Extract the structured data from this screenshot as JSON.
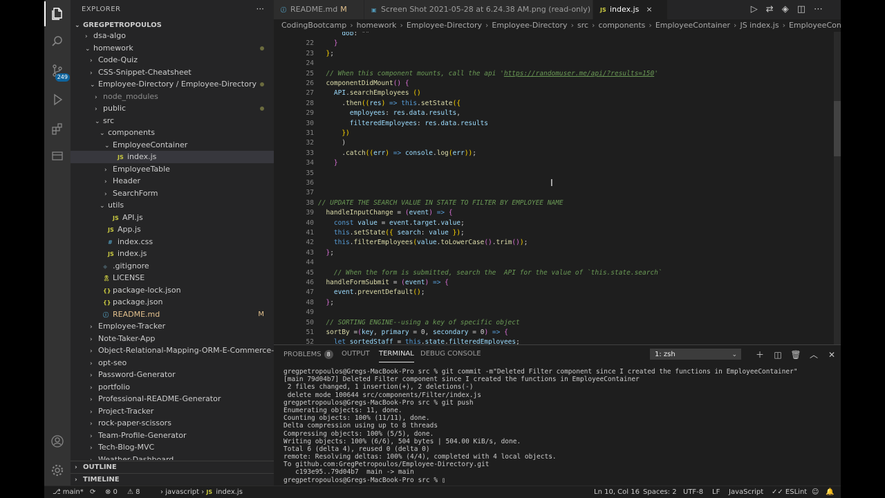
{
  "activity_bar": {
    "scm_badge": "249"
  },
  "sidebar": {
    "title": "EXPLORER",
    "more": "···",
    "root": "GREGPETROPOULOS",
    "items": [
      {
        "label": "dsa-algo",
        "indent": 1,
        "chev": "›",
        "icon": ""
      },
      {
        "label": "homework",
        "indent": 1,
        "chev": "⌄",
        "icon": "",
        "dot": true
      },
      {
        "label": "Code-Quiz",
        "indent": 2,
        "chev": "›",
        "icon": ""
      },
      {
        "label": "CSS-Snippet-Cheatsheet",
        "indent": 2,
        "chev": "›",
        "icon": ""
      },
      {
        "label": "Employee-Directory / Employee-Directory",
        "indent": 2,
        "chev": "⌄",
        "icon": "",
        "dot": true
      },
      {
        "label": "node_modules",
        "indent": 3,
        "chev": "›",
        "icon": "",
        "dim": true
      },
      {
        "label": "public",
        "indent": 3,
        "chev": "›",
        "icon": "",
        "dot": true
      },
      {
        "label": "src",
        "indent": 3,
        "chev": "⌄",
        "icon": ""
      },
      {
        "label": "components",
        "indent": 4,
        "chev": "⌄",
        "icon": ""
      },
      {
        "label": "EmployeeContainer",
        "indent": 5,
        "chev": "⌄",
        "icon": ""
      },
      {
        "label": "index.js",
        "indent": 6,
        "chev": "",
        "icon": "JS",
        "icls": "js",
        "selected": true
      },
      {
        "label": "EmployeeTable",
        "indent": 5,
        "chev": "›",
        "icon": ""
      },
      {
        "label": "Header",
        "indent": 5,
        "chev": "›",
        "icon": ""
      },
      {
        "label": "SearchForm",
        "indent": 5,
        "chev": "›",
        "icon": ""
      },
      {
        "label": "utils",
        "indent": 4,
        "chev": "⌄",
        "icon": ""
      },
      {
        "label": "API.js",
        "indent": 5,
        "chev": "",
        "icon": "JS",
        "icls": "js"
      },
      {
        "label": "App.js",
        "indent": 4,
        "chev": "",
        "icon": "JS",
        "icls": "js"
      },
      {
        "label": "index.css",
        "indent": 4,
        "chev": "",
        "icon": "#",
        "icls": "css"
      },
      {
        "label": "index.js",
        "indent": 4,
        "chev": "",
        "icon": "JS",
        "icls": "js"
      },
      {
        "label": ".gitignore",
        "indent": 3,
        "chev": "",
        "icon": "◆",
        "icls": "gi"
      },
      {
        "label": "LICENSE",
        "indent": 3,
        "chev": "",
        "icon": "🎗",
        "icls": "lic"
      },
      {
        "label": "package-lock.json",
        "indent": 3,
        "chev": "",
        "icon": "{}",
        "icls": "json"
      },
      {
        "label": "package.json",
        "indent": 3,
        "chev": "",
        "icon": "{}",
        "icls": "json"
      },
      {
        "label": "README.md",
        "indent": 3,
        "chev": "",
        "icon": "ⓘ",
        "icls": "md",
        "modified": "M"
      },
      {
        "label": "Employee-Tracker",
        "indent": 2,
        "chev": "›",
        "icon": ""
      },
      {
        "label": "Note-Taker-App",
        "indent": 2,
        "chev": "›",
        "icon": ""
      },
      {
        "label": "Object-Relational-Mapping-ORM-E-Commerce-B...",
        "indent": 2,
        "chev": "›",
        "icon": ""
      },
      {
        "label": "opt-seo",
        "indent": 2,
        "chev": "›",
        "icon": ""
      },
      {
        "label": "Password-Generator",
        "indent": 2,
        "chev": "›",
        "icon": ""
      },
      {
        "label": "portfolio",
        "indent": 2,
        "chev": "›",
        "icon": ""
      },
      {
        "label": "Professional-README-Generator",
        "indent": 2,
        "chev": "›",
        "icon": ""
      },
      {
        "label": "Project-Tracker",
        "indent": 2,
        "chev": "›",
        "icon": ""
      },
      {
        "label": "rock-paper-scissors",
        "indent": 2,
        "chev": "›",
        "icon": ""
      },
      {
        "label": "Team-Profile-Generator",
        "indent": 2,
        "chev": "›",
        "icon": ""
      },
      {
        "label": "Tech-Blog-MVC",
        "indent": 2,
        "chev": "›",
        "icon": ""
      },
      {
        "label": "Weather-Dashboard",
        "indent": 2,
        "chev": "›",
        "icon": ""
      }
    ],
    "outline": "OUTLINE",
    "timeline": "TIMELINE"
  },
  "tabs": [
    {
      "label": "README.md",
      "flag": "M",
      "flag_type": "m",
      "icon": "ⓘ"
    },
    {
      "label": "Screen Shot 2021-05-28 at 6.24.38 AM.png (read-only)",
      "flag": "U",
      "flag_type": "u",
      "icon": "▣"
    },
    {
      "label": "index.js",
      "flag": "×",
      "flag_type": "x",
      "icon": "JS",
      "active": true
    }
  ],
  "breadcrumb": [
    "CodingBootcamp",
    "homework",
    "Employee-Directory",
    "Employee-Directory",
    "src",
    "components",
    "EmployeeContainer",
    "JS index.js",
    "EmployeeContainer",
    "stat"
  ],
  "code_lines": [
    {
      "n": "",
      "html": "      <span class='c-var'>dob</span><span class='c-pun'>: </span><span class='c-pun'>\"\"</span>"
    },
    {
      "n": "22",
      "html": "    <span class='br2'>}</span>"
    },
    {
      "n": "23",
      "html": "  <span class='br1'>}</span><span class='c-pun'>;</span>"
    },
    {
      "n": "24",
      "html": ""
    },
    {
      "n": "25",
      "html": "  <span class='c-com'>// When this component mounts, call the api '</span><span class='c-link'>https://randomuser.me/api/?results=150</span><span class='c-com'>'</span>"
    },
    {
      "n": "26",
      "html": "  <span class='c-fn'>componentDidMount</span><span class='br2'>()</span> <span class='br2'>{</span>"
    },
    {
      "n": "27",
      "html": "    <span class='c-var'>API</span><span class='c-pun'>.</span><span class='c-fn'>searchEmployees</span> <span class='br1'>()</span>"
    },
    {
      "n": "28",
      "html": "      <span class='c-pun'>.</span><span class='c-fn'>then</span><span class='br1'>((</span><span class='c-var'>res</span><span class='br1'>)</span> <span class='c-kw'>=&gt;</span> <span class='c-kw'>this</span><span class='c-pun'>.</span><span class='c-fn'>setState</span><span class='br1'>({</span>"
    },
    {
      "n": "29",
      "html": "        <span class='c-var'>employees</span><span class='c-pun'>: </span><span class='c-var'>res</span><span class='c-pun'>.</span><span class='c-var'>data</span><span class='c-pun'>.</span><span class='c-var'>results</span><span class='c-pun'>,</span>"
    },
    {
      "n": "30",
      "html": "        <span class='c-var'>filteredEmployees</span><span class='c-pun'>: </span><span class='c-var'>res</span><span class='c-pun'>.</span><span class='c-var'>data</span><span class='c-pun'>.</span><span class='c-var'>results</span>"
    },
    {
      "n": "31",
      "html": "      <span class='br1'>})</span>"
    },
    {
      "n": "32",
      "html": "      <span class='c-pun'>)</span>"
    },
    {
      "n": "33",
      "html": "      <span class='c-pun'>.</span><span class='c-fn'>catch</span><span class='br1'>((</span><span class='c-var'>err</span><span class='br1'>)</span> <span class='c-kw'>=&gt;</span> <span class='c-var'>console</span><span class='c-pun'>.</span><span class='c-fn'>log</span><span class='br1'>(</span><span class='c-var'>err</span><span class='br1'>))</span><span class='c-pun'>;</span>"
    },
    {
      "n": "34",
      "html": "    <span class='br2'>}</span>"
    },
    {
      "n": "35",
      "html": ""
    },
    {
      "n": "36",
      "html": ""
    },
    {
      "n": "37",
      "html": ""
    },
    {
      "n": "38",
      "html": "<span class='c-com'>// UPDATE THE SEARCH VALUE IN STATE TO FILTER BY EMPLOYEE NAME</span>"
    },
    {
      "n": "39",
      "html": "  <span class='c-fn'>handleInputChange</span> <span class='c-pun'>=</span> <span class='br2'>(</span><span class='c-var'>event</span><span class='br2'>)</span> <span class='c-kw'>=&gt;</span> <span class='br2'>{</span>"
    },
    {
      "n": "40",
      "html": "    <span class='c-kw'>const</span> <span class='c-var'>value</span> <span class='c-pun'>=</span> <span class='c-var'>event</span><span class='c-pun'>.</span><span class='c-var'>target</span><span class='c-pun'>.</span><span class='c-var'>value</span><span class='c-pun'>;</span>"
    },
    {
      "n": "41",
      "html": "    <span class='c-kw'>this</span><span class='c-pun'>.</span><span class='c-fn'>setState</span><span class='br1'>({</span> <span class='c-var'>search</span><span class='c-pun'>: </span><span class='c-var'>value</span> <span class='br1'>})</span><span class='c-pun'>;</span>"
    },
    {
      "n": "42",
      "html": "    <span class='c-kw'>this</span><span class='c-pun'>.</span><span class='c-fn'>filterEmployees</span><span class='br1'>(</span><span class='c-var'>value</span><span class='c-pun'>.</span><span class='c-fn'>toLowerCase</span><span class='br2'>()</span><span class='c-pun'>.</span><span class='c-fn'>trim</span><span class='br2'>()</span><span class='br1'>)</span><span class='c-pun'>;</span>"
    },
    {
      "n": "43",
      "html": "  <span class='br2'>}</span><span class='c-pun'>;</span>"
    },
    {
      "n": "44",
      "html": ""
    },
    {
      "n": "45",
      "html": "    <span class='c-com'>// When the form is submitted, search the  API for the value of `this.state.search`</span>"
    },
    {
      "n": "46",
      "html": "  <span class='c-fn'>handleFormSubmit</span> <span class='c-pun'>=</span> <span class='br2'>(</span><span class='c-var'>event</span><span class='br2'>)</span> <span class='c-kw'>=&gt;</span> <span class='br2'>{</span>"
    },
    {
      "n": "47",
      "html": "    <span class='c-var'>event</span><span class='c-pun'>.</span><span class='c-fn'>preventDefault</span><span class='br1'>()</span><span class='c-pun'>;</span>"
    },
    {
      "n": "48",
      "html": "  <span class='br2'>}</span><span class='c-pun'>;</span>"
    },
    {
      "n": "49",
      "html": ""
    },
    {
      "n": "50",
      "html": "  <span class='c-com'>// SORTING ENGINE--using a key of specific object</span>"
    },
    {
      "n": "51",
      "html": "  <span class='c-fn'>sortBy</span> <span class='c-pun'>=</span><span class='br2'>(</span><span class='c-var'>key</span><span class='c-pun'>, </span><span class='c-var'>primary</span> <span class='c-pun'>=</span> <span class='c-pun'>0, </span><span class='c-var'>secondary</span> <span class='c-pun'>=</span> <span class='c-pun'>0</span><span class='br2'>)</span> <span class='c-kw'>=&gt;</span> <span class='br2'>{</span>"
    },
    {
      "n": "52",
      "html": "    <span class='c-kw'>let</span> <span class='c-var'>sortedStaff</span> <span class='c-pun'>=</span> <span class='c-kw'>this</span><span class='c-pun'>.</span><span class='c-var'>state</span><span class='c-pun'>.</span><span class='c-var'>filteredEmployees</span><span class='c-pun'>;</span>"
    }
  ],
  "panel": {
    "tabs": {
      "problems": "PROBLEMS",
      "problems_count": "8",
      "output": "OUTPUT",
      "terminal": "TERMINAL",
      "debug": "DEBUG CONSOLE"
    },
    "shell": "1: zsh",
    "terminal_lines": [
      "gregpetropoulos@Gregs-MacBook-Pro src % git commit -m\"Deleted Filter component since I created the functions in EmployeeContainer\"",
      "[main 79d04b7] Deleted Filter component since I created the functions in EmployeeContainer",
      " 2 files changed, 1 insertion(+), 2 deletions(-)",
      " delete mode 100644 src/components/Filter/index.js",
      "gregpetropoulos@Gregs-MacBook-Pro src % git push",
      "Enumerating objects: 11, done.",
      "Counting objects: 100% (11/11), done.",
      "Delta compression using up to 8 threads",
      "Compressing objects: 100% (5/5), done.",
      "Writing objects: 100% (6/6), 504 bytes | 504.00 KiB/s, done.",
      "Total 6 (delta 4), reused 0 (delta 0)",
      "remote: Resolving deltas: 100% (4/4), completed with 4 local objects.",
      "To github.com:GregPetropoulos/Employee-Directory.git",
      "   c193e95..79d04b7  main -> main",
      "gregpetropoulos@Gregs-MacBook-Pro src % ▯"
    ]
  },
  "status": {
    "branch": "main*",
    "sync": "⟳",
    "errors": "⊗ 0",
    "warnings": "⚠ 8",
    "lang_path": "javascript",
    "file": "index.js",
    "position": "Ln 10, Col 16",
    "spaces": "Spaces: 2",
    "encoding": "UTF-8",
    "eol": "LF",
    "language": "JavaScript",
    "linter": "✓✓ ESLint"
  }
}
